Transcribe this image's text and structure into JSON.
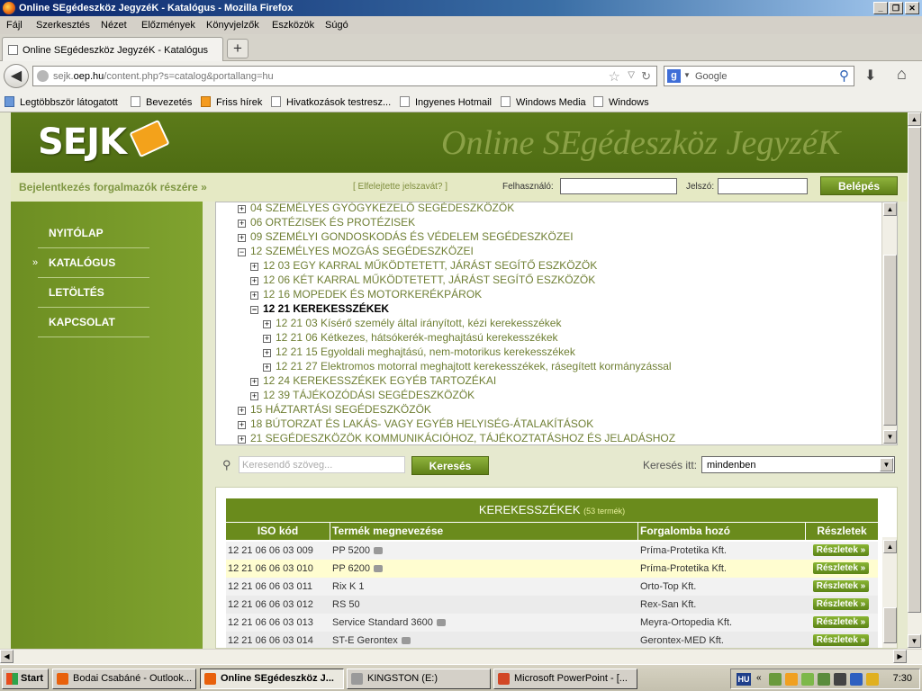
{
  "window": {
    "title": "Online SEgédeszköz JegyzéK - Katalógus - Mozilla Firefox",
    "minimize": "_",
    "maximize": "❐",
    "close": "✕"
  },
  "menu": [
    "Fájl",
    "Szerkesztés",
    "Nézet",
    "Előzmények",
    "Könyvjelzők",
    "Eszközök",
    "Súgó"
  ],
  "tab": {
    "label": "Online SEgédeszköz JegyzéK - Katalógus",
    "new_tab": "+"
  },
  "nav": {
    "url_prefix": "sejk.",
    "url_domain": "oep.hu",
    "url_rest": "/content.php?s=catalog&portallang=hu",
    "search_engine": "Google",
    "search_placeholder": "Google"
  },
  "bookmarks": [
    {
      "label": "Legtöbbször látogatott",
      "icon": "blue"
    },
    {
      "label": "Bevezetés",
      "icon": "page"
    },
    {
      "label": "Friss hírek",
      "icon": "rss"
    },
    {
      "label": "Hivatkozások testresz...",
      "icon": "page"
    },
    {
      "label": "Ingyenes Hotmail",
      "icon": "page"
    },
    {
      "label": "Windows Media",
      "icon": "page"
    },
    {
      "label": "Windows",
      "icon": "page"
    }
  ],
  "site": {
    "logo": "SEJK",
    "tagline": "Online SEgédeszköz JegyzéK",
    "login": {
      "left_link": "Bejelentkezés forgalmazók részére »",
      "forgot": "[ Elfelejtette jelszavát? ]",
      "user_label": "Felhasználó:",
      "pass_label": "Jelszó:",
      "button": "Belépés"
    },
    "nav_items": [
      "NYITÓLAP",
      "KATALÓGUS",
      "LETÖLTÉS",
      "KAPCSOLAT"
    ],
    "active_nav": "KATALÓGUS"
  },
  "tree": [
    {
      "label": "04 SZEMÉLYES GYÓGYKEZELŐ SEGÉDESZKÖZÖK",
      "level": 0,
      "sign": "+"
    },
    {
      "label": "06 ORTÉZISEK ÉS PROTÉZISEK",
      "level": 0,
      "sign": "+"
    },
    {
      "label": "09 SZEMÉLYI GONDOSKODÁS ÉS VÉDELEM SEGÉDESZKÖZEI",
      "level": 0,
      "sign": "+"
    },
    {
      "label": "12 SZEMÉLYES MOZGÁS SEGÉDESZKÖZEI",
      "level": 0,
      "sign": "−"
    },
    {
      "label": "12 03 EGY KARRAL MŰKÖDTETETT, JÁRÁST SEGÍTŐ ESZKÖZÖK",
      "level": 1,
      "sign": "+"
    },
    {
      "label": "12 06 KÉT KARRAL MŰKÖDTETETT, JÁRÁST SEGÍTŐ ESZKÖZÖK",
      "level": 1,
      "sign": "+"
    },
    {
      "label": "12 16 MOPEDEK ÉS MOTORKERÉKPÁROK",
      "level": 1,
      "sign": "+"
    },
    {
      "label": "12 21 KEREKESSZÉKEK",
      "level": 1,
      "sign": "−",
      "active": true
    },
    {
      "label": "12 21 03 Kísérő személy által irányított, kézi kerekesszékek",
      "level": 2,
      "sign": "+"
    },
    {
      "label": "12 21 06 Kétkezes, hátsókerék-meghajtású kerekesszékek",
      "level": 2,
      "sign": "+"
    },
    {
      "label": "12 21 15 Egyoldali meghajtású, nem-motorikus kerekesszékek",
      "level": 2,
      "sign": "+"
    },
    {
      "label": "12 21 27 Elektromos motorral meghajtott kerekesszékek, rásegített kormányzással",
      "level": 2,
      "sign": "+"
    },
    {
      "label": "12 24 KEREKESSZÉKEK EGYÉB TARTOZÉKAI",
      "level": 1,
      "sign": "+"
    },
    {
      "label": "12 39 TÁJÉKOZÓDÁSI SEGÉDESZKÖZÖK",
      "level": 1,
      "sign": "+"
    },
    {
      "label": "15 HÁZTARTÁSI SEGÉDESZKÖZÖK",
      "level": 0,
      "sign": "+"
    },
    {
      "label": "18 BÚTORZAT ÉS LAKÁS- VAGY EGYÉB HELYISÉG-ÁTALAKÍTÁSOK",
      "level": 0,
      "sign": "+"
    },
    {
      "label": "21 SEGÉDESZKÖZÖK KOMMUNIKÁCIÓHOZ, TÁJÉKOZTATÁSHOZ ÉS JELADÁSHOZ",
      "level": 0,
      "sign": "+"
    }
  ],
  "search": {
    "placeholder": "Keresendő szöveg...",
    "button": "Keresés",
    "scope_label": "Keresés itt:",
    "scope_value": "mindenben"
  },
  "results": {
    "title": "KEREKESSZÉKEK",
    "count": "(53 termék)",
    "columns": [
      "ISO kód",
      "Termék megnevezése",
      "Forgalomba hozó",
      "Részletek"
    ],
    "details_button": "Részletek »",
    "rows": [
      {
        "iso": "12 21 06 06 03 009",
        "name": "PP 5200",
        "camera": true,
        "vendor": "Príma-Protetika Kft."
      },
      {
        "iso": "12 21 06 06 03 010",
        "name": "PP 6200",
        "camera": true,
        "vendor": "Príma-Protetika Kft.",
        "highlight": true
      },
      {
        "iso": "12 21 06 06 03 011",
        "name": "Rix K 1",
        "camera": false,
        "vendor": "Orto-Top Kft."
      },
      {
        "iso": "12 21 06 06 03 012",
        "name": "RS 50",
        "camera": false,
        "vendor": "Rex-San Kft."
      },
      {
        "iso": "12 21 06 06 03 013",
        "name": "Service Standard 3600",
        "camera": true,
        "vendor": "Meyra-Ortopedia Kft."
      },
      {
        "iso": "12 21 06 06 03 014",
        "name": "ST-E Gerontex",
        "camera": true,
        "vendor": "Gerontex-MED Kft."
      }
    ]
  },
  "taskbar": {
    "start": "Start",
    "buttons": [
      {
        "label": "Bodai Csabáné - Outlook...",
        "color": "#e8610c"
      },
      {
        "label": "Online SEgédeszköz J...",
        "color": "#e8610c",
        "active": true
      },
      {
        "label": "KINGSTON (E:)",
        "color": "#9a9a9a"
      },
      {
        "label": "Microsoft PowerPoint - [...",
        "color": "#d24726"
      }
    ],
    "lang": "HU",
    "clock": "7:30"
  }
}
